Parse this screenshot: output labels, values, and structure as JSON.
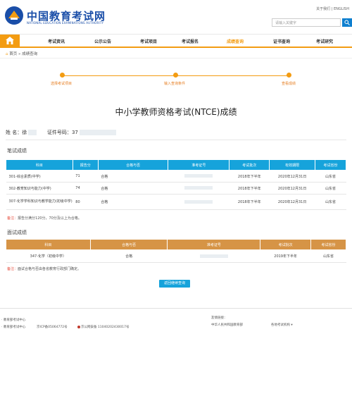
{
  "header": {
    "site_name": "中国教育考试网",
    "site_name_en": "NATIONAL EDUCATION EXAMINATIONS AUTHORITY",
    "top_links": "关于我们  |  ENGLISH",
    "search_placeholder": "请输入关键字"
  },
  "nav": {
    "items": [
      "考试资讯",
      "公示公告",
      "考试项目",
      "考试报名",
      "成绩查询",
      "证书查询",
      "考试研究"
    ],
    "active": "成绩查询"
  },
  "breadcrumb": "首页 » 成绩查询",
  "steps": [
    "选择考试项目",
    "输入查询条件",
    "查看成绩"
  ],
  "page_title": "中小学教师资格考试(NTCE)成绩",
  "person": {
    "name_label": "姓 名：",
    "name_value": "徐",
    "id_label": "证件号码：",
    "id_value": "37"
  },
  "written": {
    "title": "笔试成绩",
    "headers": [
      "科目",
      "报告分",
      "合格与否",
      "准考证号",
      "考试批次",
      "有效期限",
      "考试省份"
    ],
    "rows": [
      {
        "subject": "301-综合素质(中学)",
        "score": "71",
        "pass": "合格",
        "ticket": "",
        "batch": "2018年下半年",
        "valid": "2020年12月31日",
        "province": "山东省"
      },
      {
        "subject": "302-教育知识与能力(中学)",
        "score": "74",
        "pass": "合格",
        "ticket": "",
        "batch": "2018年下半年",
        "valid": "2020年12月31日",
        "province": "山东省"
      },
      {
        "subject": "307-化学学科知识与教学能力(初级中学)",
        "score": "80",
        "pass": "合格",
        "ticket": "",
        "batch": "2018年下半年",
        "valid": "2020年12月31日",
        "province": "山东省"
      }
    ],
    "note_star": "备注：",
    "note": "报告分满分120分，70分及以上为合格。"
  },
  "interview": {
    "title": "面试成绩",
    "headers": [
      "科目",
      "合格与否",
      "准考证号",
      "考试批次",
      "考试省份"
    ],
    "rows": [
      {
        "subject": "347-化学（初级中学）",
        "pass": "合格",
        "ticket": "",
        "batch": "2019年下半年",
        "province": "山东省"
      }
    ],
    "note_star": "备注：",
    "note": "面试合格与否由各省教育行政部门确定。"
  },
  "back_button": "返回继续查询",
  "footer": {
    "org1": "· 教育部考试中心",
    "org2": "· 教育部考试中心",
    "icp": "京ICP备05064772号",
    "police": "京公网安备 11040202430017号",
    "friend_label": "友情链接：",
    "friend1": "中华人民共和国教育部",
    "friend2": "各地考试机构 ▾"
  },
  "colors": {
    "accent": "#f39c12",
    "table_header": "#16a3db",
    "interview_header": "#d69446",
    "brand": "#1a4ea8"
  }
}
